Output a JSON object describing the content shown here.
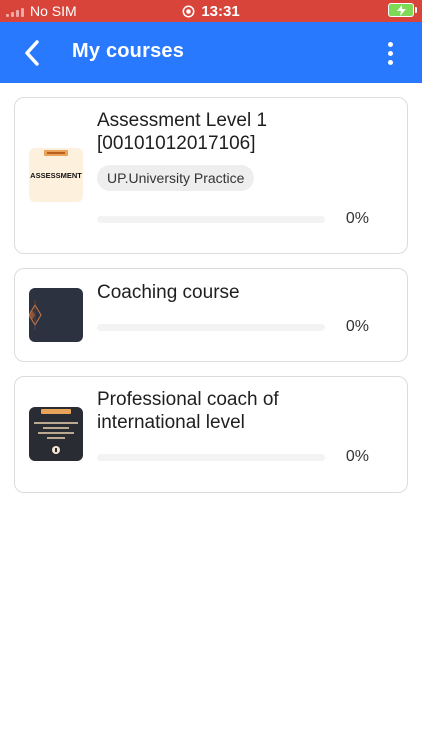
{
  "status_bar": {
    "carrier": "No SIM",
    "time": "13:31",
    "battery_color": "#7ed957"
  },
  "app_bar": {
    "title": "My courses",
    "background": "#2979ff",
    "back_icon": "chevron-left-icon",
    "menu_icon": "more-vertical-icon"
  },
  "courses": [
    {
      "title_line1": "Assessment Level 1",
      "title_line2": "[00101012017106]",
      "tag": "UP.University Practice",
      "thumb_text": "ASSESSMENT",
      "progress_label": "0%",
      "progress_value": 0
    },
    {
      "title_line1": "Coaching course",
      "progress_label": "0%",
      "progress_value": 0
    },
    {
      "title_line1": "Professional coach of",
      "title_line2": "international level",
      "progress_label": "0%",
      "progress_value": 0
    }
  ]
}
